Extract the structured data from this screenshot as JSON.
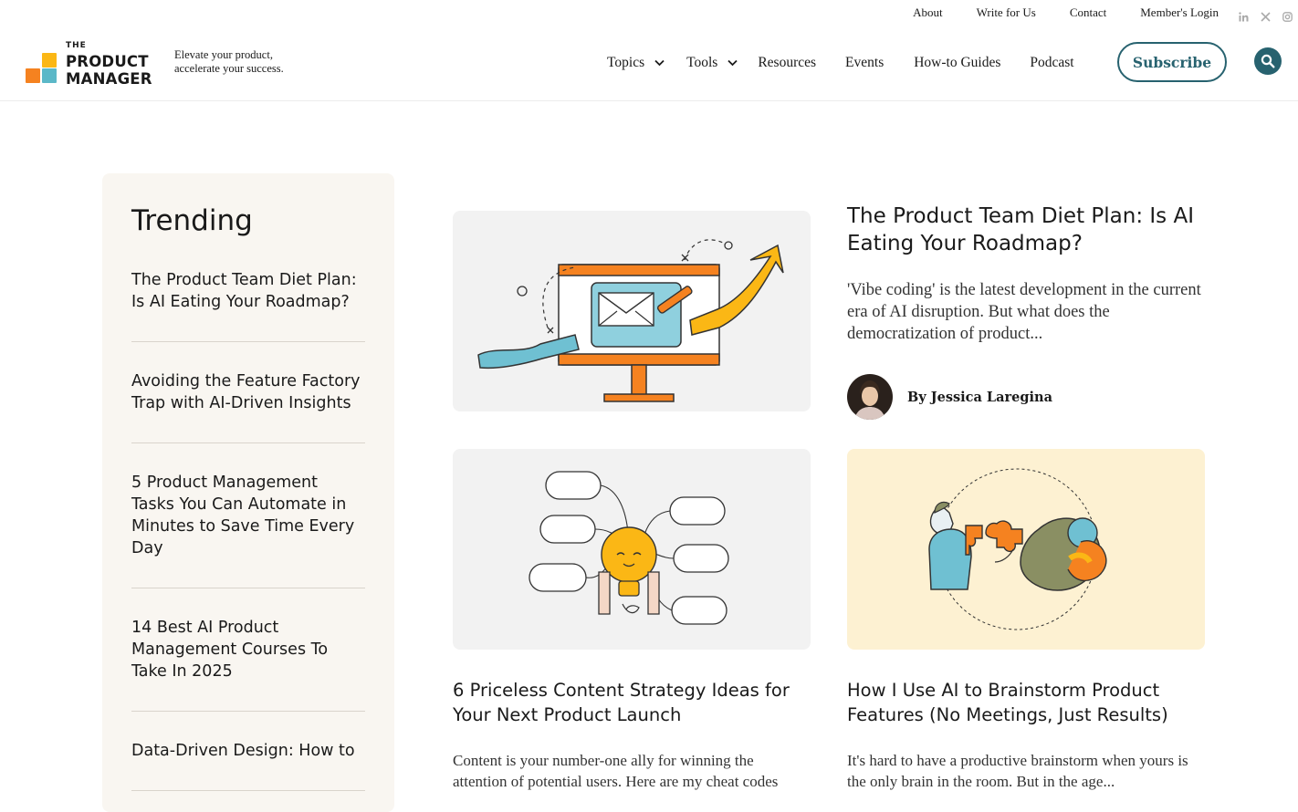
{
  "utility": {
    "links": [
      "About",
      "Write for Us",
      "Contact",
      "Member's Login"
    ],
    "social": [
      "linkedin-icon",
      "x-twitter-icon",
      "instagram-icon"
    ]
  },
  "brand": {
    "logo_the": "THE",
    "logo_line1": "PRODUCT",
    "logo_line2": "MANAGER",
    "tagline_line1": "Elevate your product,",
    "tagline_line2": "accelerate your success.",
    "colors": {
      "orange": "#f58220",
      "yellow": "#fbb715",
      "teal": "#5bb8c8",
      "accent": "#27626f"
    }
  },
  "nav": {
    "items": [
      {
        "label": "Topics",
        "dropdown": true
      },
      {
        "label": "Tools",
        "dropdown": true
      },
      {
        "label": "Resources",
        "dropdown": false
      },
      {
        "label": "Events",
        "dropdown": false
      },
      {
        "label": "How-to Guides",
        "dropdown": false
      },
      {
        "label": "Podcast",
        "dropdown": false
      }
    ],
    "subscribe_label": "Subscribe"
  },
  "trending": {
    "heading": "Trending",
    "items": [
      "The Product Team Diet Plan: Is AI Eating Your Roadmap?",
      "Avoiding the Feature Factory Trap with AI-Driven Insights",
      "5 Product Management Tasks You Can Automate in Minutes to Save Time Every Day",
      "14 Best AI Product Management Courses To Take In 2025",
      "Data-Driven Design: How to"
    ]
  },
  "featured": {
    "title": "The Product Team Diet Plan: Is AI Eating Your Roadmap?",
    "excerpt": "'Vibe coding' is the latest development in the current era of AI disruption. But what does the democratization of product...",
    "author": "By Jessica Laregina"
  },
  "cards": [
    {
      "title": "6 Priceless Content Strategy Ideas for Your Next Product Launch",
      "excerpt": "Content is your number-one ally for winning the attention of potential users. Here are my cheat codes"
    },
    {
      "title": "How I Use AI to Brainstorm Product Features (No Meetings, Just Results)",
      "excerpt": "It's hard to have a productive brainstorm when yours is the only brain in the room. But in the age..."
    }
  ]
}
